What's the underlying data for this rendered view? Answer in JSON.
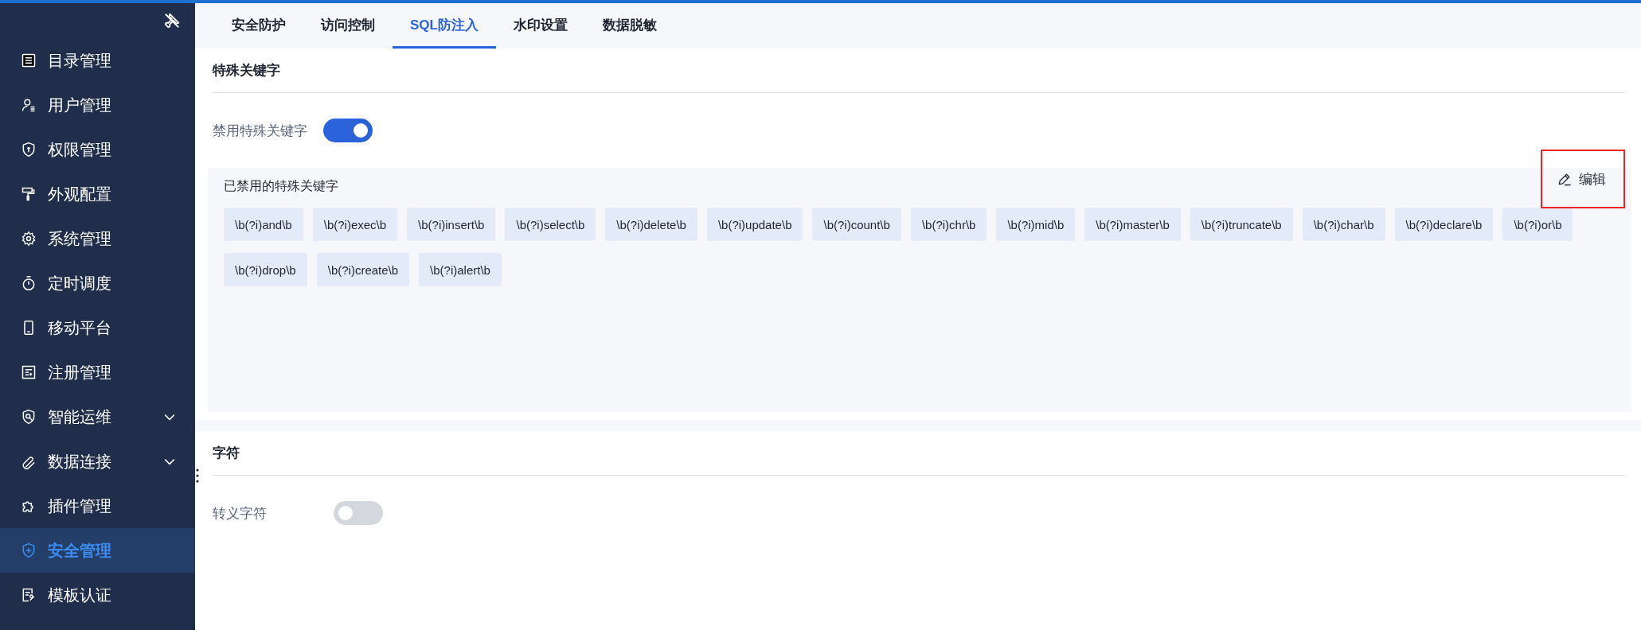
{
  "sidebar": {
    "items": [
      {
        "label": "目录管理",
        "kind": "link",
        "selected": false
      },
      {
        "label": "用户管理",
        "kind": "link",
        "selected": false
      },
      {
        "label": "权限管理",
        "kind": "link",
        "selected": false
      },
      {
        "label": "外观配置",
        "kind": "link",
        "selected": false
      },
      {
        "label": "系统管理",
        "kind": "link",
        "selected": false
      },
      {
        "label": "定时调度",
        "kind": "link",
        "selected": false
      },
      {
        "label": "移动平台",
        "kind": "link",
        "selected": false
      },
      {
        "label": "注册管理",
        "kind": "link",
        "selected": false
      },
      {
        "label": "智能运维",
        "kind": "group",
        "selected": false
      },
      {
        "label": "数据连接",
        "kind": "group",
        "selected": false
      },
      {
        "label": "插件管理",
        "kind": "link",
        "selected": false
      },
      {
        "label": "安全管理",
        "kind": "link",
        "selected": true
      },
      {
        "label": "模板认证",
        "kind": "link",
        "selected": false
      }
    ]
  },
  "tabs": [
    {
      "label": "安全防护",
      "selected": false
    },
    {
      "label": "访问控制",
      "selected": false
    },
    {
      "label": "SQL防注入",
      "selected": true
    },
    {
      "label": "水印设置",
      "selected": false
    },
    {
      "label": "数据脱敏",
      "selected": false
    }
  ],
  "keyword_section": {
    "title": "特殊关键字",
    "toggle": {
      "label": "禁用特殊关键字",
      "on": true
    },
    "panel": {
      "title": "已禁用的特殊关键字",
      "edit_button": "编辑",
      "tags": [
        "\\b(?i)and\\b",
        "\\b(?i)exec\\b",
        "\\b(?i)insert\\b",
        "\\b(?i)select\\b",
        "\\b(?i)delete\\b",
        "\\b(?i)update\\b",
        "\\b(?i)count\\b",
        "\\b(?i)chr\\b",
        "\\b(?i)mid\\b",
        "\\b(?i)master\\b",
        "\\b(?i)truncate\\b",
        "\\b(?i)char\\b",
        "\\b(?i)declare\\b",
        "\\b(?i)or\\b",
        "\\b(?i)drop\\b",
        "\\b(?i)create\\b",
        "\\b(?i)alert\\b"
      ]
    }
  },
  "char_section": {
    "title": "字符",
    "toggle": {
      "label": "转义字符",
      "on": false
    }
  }
}
